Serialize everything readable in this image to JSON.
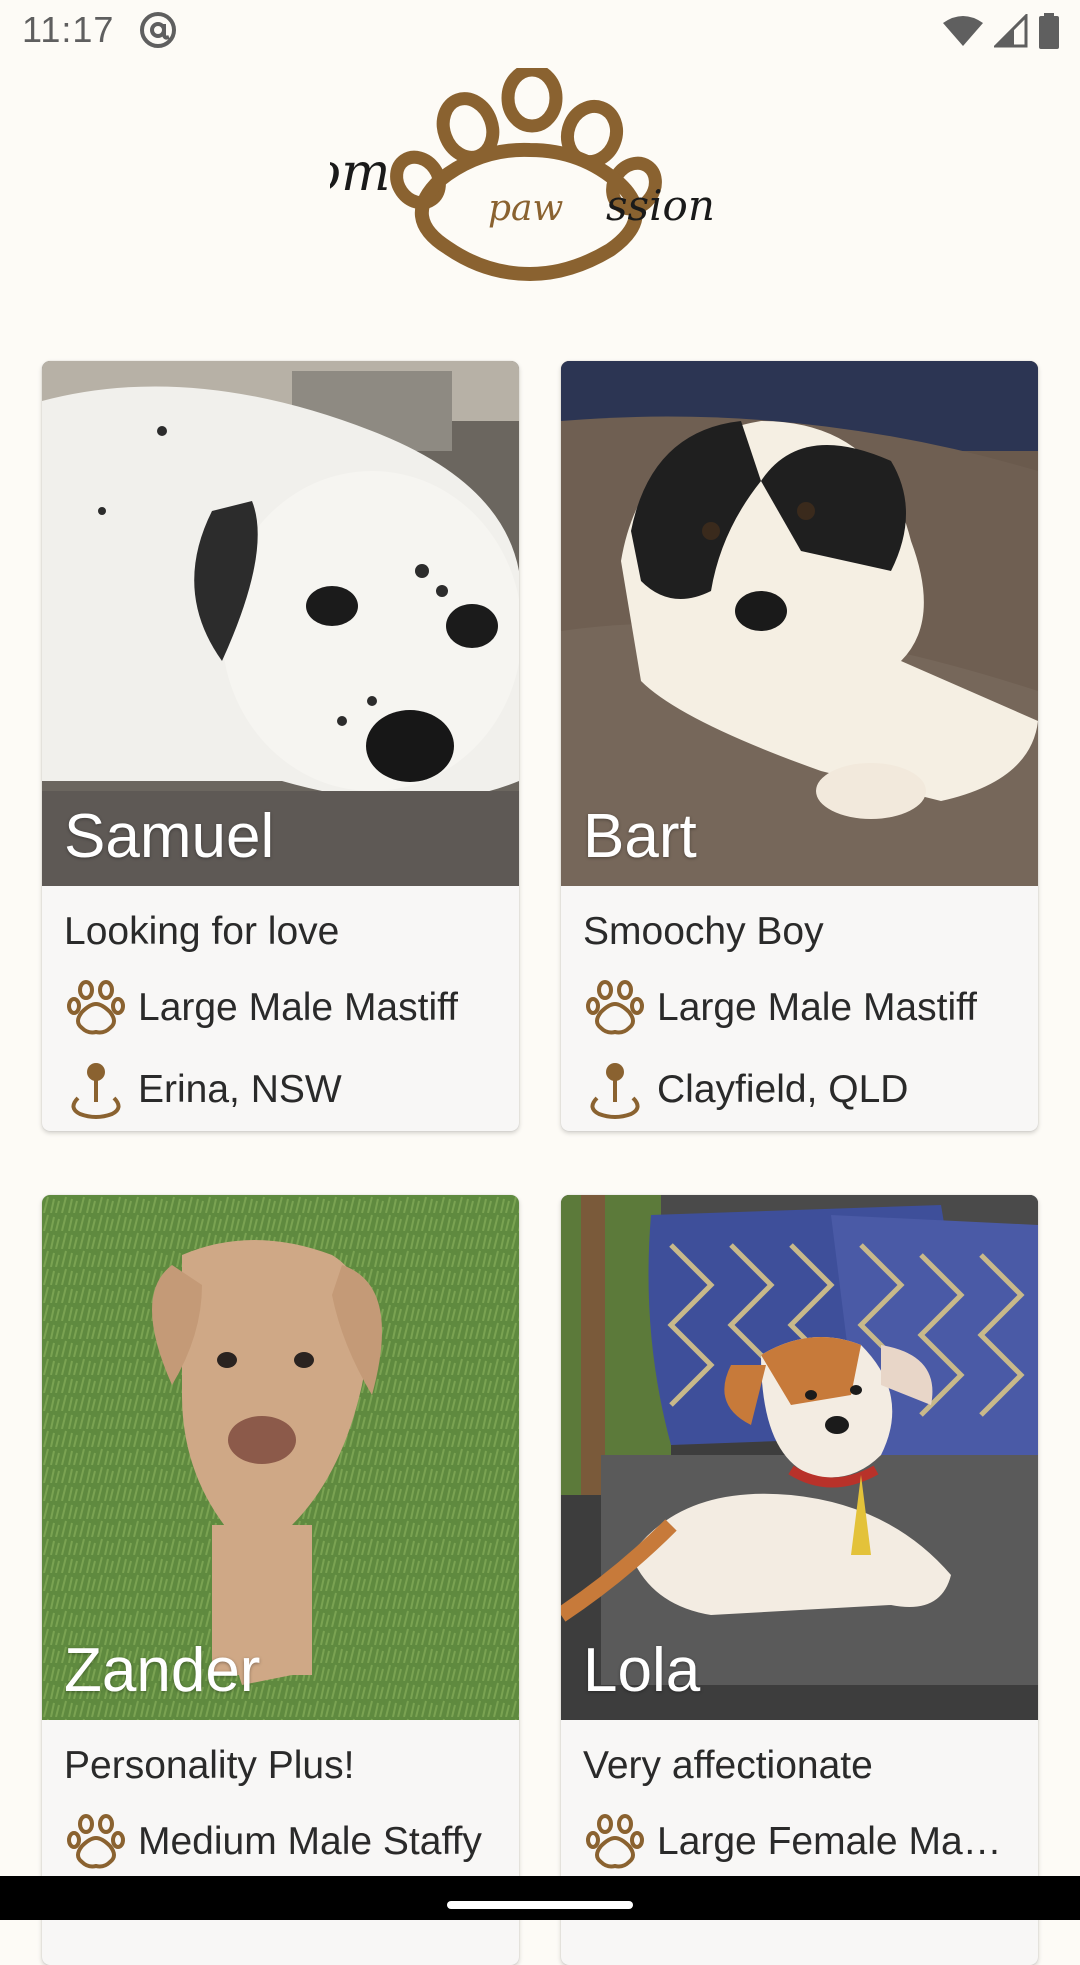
{
  "status_bar": {
    "time": "11:17",
    "icons": [
      "at-sign-icon",
      "wifi-icon",
      "cellular-signal-icon",
      "battery-icon"
    ]
  },
  "app": {
    "logo_text_left": "Com",
    "logo_text_center": "paw",
    "logo_text_right": "ssion",
    "brand_color": "#8a6230"
  },
  "pets": [
    {
      "name": "Samuel",
      "tagline": "Looking for love",
      "breed": "Large Male Mastiff",
      "location": "Erina, NSW"
    },
    {
      "name": "Bart",
      "tagline": "Smoochy Boy",
      "breed": "Large Male Mastiff",
      "location": "Clayfield, QLD"
    },
    {
      "name": "Zander",
      "tagline": "Personality Plus!",
      "breed": "Medium Male Staffy"
    },
    {
      "name": "Lola",
      "tagline": "Very affectionate",
      "breed": "Large Female Mastiff"
    }
  ],
  "icons": {
    "breed": "paw-icon",
    "location": "location-pin-icon"
  }
}
